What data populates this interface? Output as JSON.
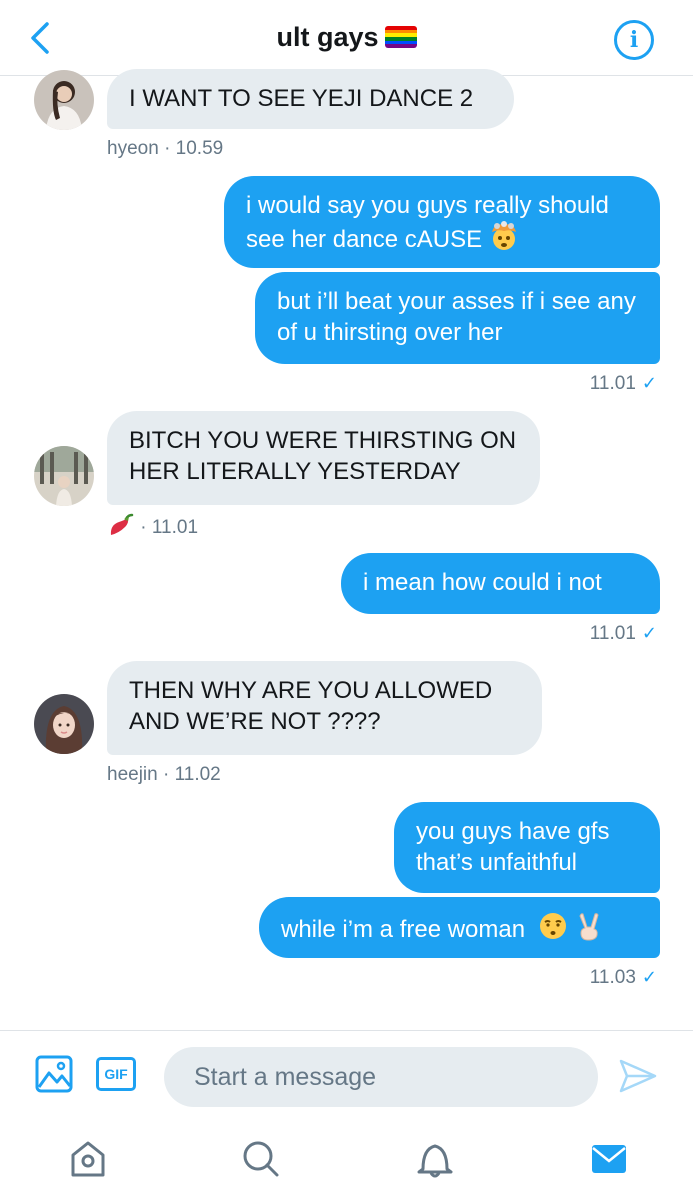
{
  "header": {
    "title": "ult gays",
    "back_icon": "chevron-left-icon",
    "info_icon": "info-icon",
    "flag_icon": "rainbow-flag-icon"
  },
  "colors": {
    "accent": "#1da1f2",
    "incoming_bubble": "#e6ecf0",
    "meta_text": "#657786"
  },
  "messages": [
    {
      "direction": "in",
      "text": "I WANT TO SEE YEJI DANCE 2",
      "sender": "hyeon",
      "time": "10.59"
    },
    {
      "direction": "out",
      "text": "i would say you guys really should see her dance cAUSE",
      "emoji": "exploding-head-emoji"
    },
    {
      "direction": "out",
      "text": "but i’ll beat your asses if i see any of u thirsting over her",
      "time": "11.01"
    },
    {
      "direction": "in",
      "text": "BITCH YOU WERE THIRSTING ON HER LITERALLY YESTERDAY",
      "sender_icon": "chili-pepper-emoji",
      "time": "11.01"
    },
    {
      "direction": "out",
      "text": "i mean how could i not",
      "time": "11.01"
    },
    {
      "direction": "in",
      "text": "THEN WHY ARE YOU ALLOWED AND WE’RE NOT ????",
      "sender": "heejin",
      "time": "11.02"
    },
    {
      "direction": "out",
      "text": "you guys have gfs that’s unfaithful"
    },
    {
      "direction": "out",
      "text": "while i’m a free woman",
      "emoji": "kissing-face-and-victory-hand-emoji",
      "time": "11.03"
    }
  ],
  "meta": {
    "sep": "·",
    "check": "✓"
  },
  "composer": {
    "placeholder": "Start a message",
    "gif_label": "GIF",
    "image_icon": "image-icon",
    "send_icon": "send-icon"
  },
  "tabbar": {
    "items": [
      "home-icon",
      "search-icon",
      "notifications-icon",
      "messages-icon"
    ],
    "active": "messages-icon"
  }
}
